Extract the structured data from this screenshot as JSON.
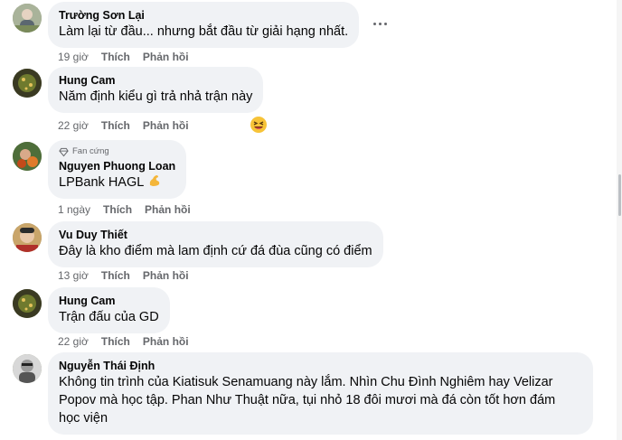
{
  "comments": [
    {
      "author": "Trường Sơn Lại",
      "text": "Làm lại từ đầu... nhưng bắt đầu từ giải hạng nhất.",
      "time": "19 giờ",
      "like": "Thích",
      "reply": "Phản hồi"
    },
    {
      "author": "Hung Cam",
      "text": "Năm định kiểu gì trả nhả trận này",
      "time": "22 giờ",
      "like": "Thích",
      "reply": "Phản hồi"
    },
    {
      "author": "Nguyen Phuong Loan",
      "badge": "Fan cứng",
      "text": "LPBank HAGL",
      "time": "1 ngày",
      "like": "Thích",
      "reply": "Phản hồi"
    },
    {
      "author": "Vu Duy Thiết",
      "text": "Đây là kho điểm mà lam định cứ đá đùa cũng có điểm",
      "time": "13 giờ",
      "like": "Thích",
      "reply": "Phản hồi"
    },
    {
      "author": "Hung Cam",
      "text": "Trận đấu của GD",
      "time": "22 giờ",
      "like": "Thích",
      "reply": "Phản hồi"
    },
    {
      "author": "Nguyễn Thái Định",
      "text_lines": [
        "Không tin trình của Kiatisuk Senamuang này lắm. Nhìn Chu Đình Nghiêm hay Velizar",
        "Popov mà học tập. Phan Như Thuật nữa, tụi nhỏ 18 đôi mươi mà đá còn tốt hơn đám",
        "học viện"
      ]
    }
  ],
  "icons": {
    "more": "more-horizontal-icon",
    "reaction": "grinning-squint-emoji-icon",
    "flexed_biceps": "flexed-biceps-emoji-icon",
    "badge": "diamond-icon"
  },
  "colors": {
    "bubble": "#f0f2f5",
    "meta_text": "#65676b",
    "name_text": "#050505"
  }
}
